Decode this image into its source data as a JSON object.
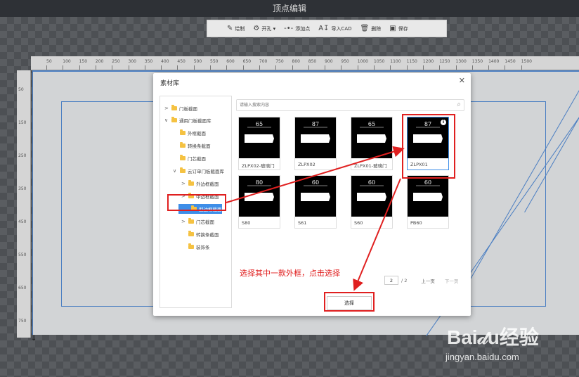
{
  "window": {
    "title": "顶点编辑"
  },
  "toolbar": {
    "items": [
      {
        "icon": "edit-icon",
        "label": "绘制"
      },
      {
        "icon": "drill-icon",
        "label": "开孔 ▾"
      },
      {
        "icon": "add-point-icon",
        "label": "添加点"
      },
      {
        "icon": "import-icon",
        "label": "导入CAD"
      },
      {
        "icon": "trash-icon",
        "label": "删除"
      },
      {
        "icon": "save-icon",
        "label": "保存"
      }
    ]
  },
  "ruler": {
    "top": [
      "50",
      "100",
      "150",
      "200",
      "250",
      "300",
      "350",
      "400",
      "450",
      "500",
      "550",
      "600",
      "650",
      "700",
      "750",
      "800",
      "850",
      "900",
      "950",
      "1000",
      "1050",
      "1100",
      "1150",
      "1200",
      "1250",
      "1300",
      "1350",
      "1400",
      "1450",
      "1500"
    ],
    "left": [
      "50",
      "150",
      "250",
      "350",
      "450",
      "550",
      "650",
      "750"
    ]
  },
  "dialog": {
    "title": "素材库",
    "tree": [
      {
        "label": "门板截面",
        "arrow": ">",
        "level": 0
      },
      {
        "label": "通用门板截面库",
        "arrow": "∨",
        "level": 0
      },
      {
        "label": "外框截面",
        "arrow": "",
        "level": 1
      },
      {
        "label": "转换条截面",
        "arrow": "",
        "level": 1
      },
      {
        "label": "门芯截面",
        "arrow": "",
        "level": 1
      },
      {
        "label": "云订单门板截面库",
        "arrow": "∨",
        "level": 1
      },
      {
        "label": "外边框截面",
        "arrow": ">",
        "level": 2
      },
      {
        "label": "中边框截面",
        "arrow": ">",
        "level": 2
      },
      {
        "label": "型边框截面",
        "arrow": "",
        "level": 2,
        "selected": true
      },
      {
        "label": "门芯截面",
        "arrow": ">",
        "level": 2
      },
      {
        "label": "转换条截面",
        "arrow": "",
        "level": 2
      },
      {
        "label": "装饰条",
        "arrow": "",
        "level": 2
      }
    ],
    "search_placeholder": "请输入搜索内容",
    "materials": [
      {
        "label": "ZLPX02-玻璃门",
        "dim": "65"
      },
      {
        "label": "ZLPX02",
        "dim": "87"
      },
      {
        "label": "ZLPX01-玻璃门",
        "dim": "65"
      },
      {
        "label": "ZLPX01",
        "dim": "87",
        "selected": true
      },
      {
        "label": "S80",
        "dim": "80"
      },
      {
        "label": "S61",
        "dim": "60"
      },
      {
        "label": "S60",
        "dim": "60"
      },
      {
        "label": "PB60",
        "dim": "60"
      }
    ],
    "pager": {
      "current": "2",
      "total": "/ 2",
      "prev": "上一页",
      "next": "下一页"
    },
    "select_button": "选择"
  },
  "annotation": "选择其中一款外框，点击选择",
  "watermark": {
    "brand": "Bai𝒹u经验",
    "url": "jingyan.baidu.com"
  },
  "colors": {
    "accent": "#3e8ee8",
    "annotation_red": "#e02020",
    "canvas_line": "#4a7ec2"
  }
}
